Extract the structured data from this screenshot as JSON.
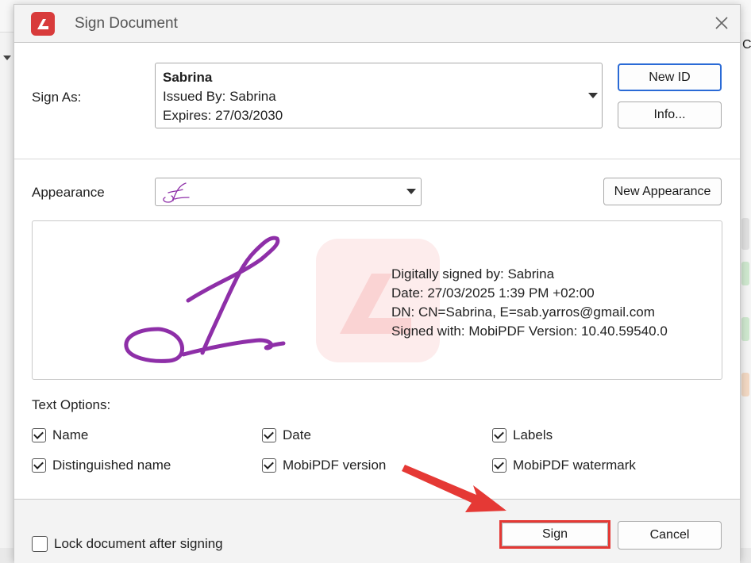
{
  "dialog": {
    "title": "Sign Document"
  },
  "sign_as": {
    "label": "Sign As:",
    "id_name": "Sabrina",
    "issued_by": "Issued By: Sabrina",
    "expires": "Expires: 27/03/2030",
    "new_id_button": "New ID",
    "info_button": "Info..."
  },
  "appearance": {
    "label": "Appearance",
    "new_appearance_button": "New Appearance"
  },
  "preview": {
    "lines": [
      "Digitally signed by: Sabrina",
      "Date: 27/03/2025 1:39 PM +02:00",
      "DN: CN=Sabrina, E=sab.yarros@gmail.com",
      "Signed with: MobiPDF Version: 10.40.59540.0"
    ]
  },
  "text_options": {
    "label": "Text Options:",
    "items": [
      {
        "label": "Name",
        "checked": true
      },
      {
        "label": "Date",
        "checked": true
      },
      {
        "label": "Labels",
        "checked": true
      },
      {
        "label": "Distinguished name",
        "checked": true
      },
      {
        "label": "MobiPDF version",
        "checked": true
      },
      {
        "label": "MobiPDF watermark",
        "checked": true
      }
    ]
  },
  "footer": {
    "lock_label": "Lock document after signing",
    "lock_checked": false,
    "sign_button": "Sign",
    "cancel_button": "Cancel"
  },
  "colors": {
    "accent": "#2a6ad6",
    "brand": "#d83b3b",
    "signature_ink": "#8e2fa8",
    "annotation": "#e53935"
  },
  "background": {
    "partial_text": "C"
  }
}
